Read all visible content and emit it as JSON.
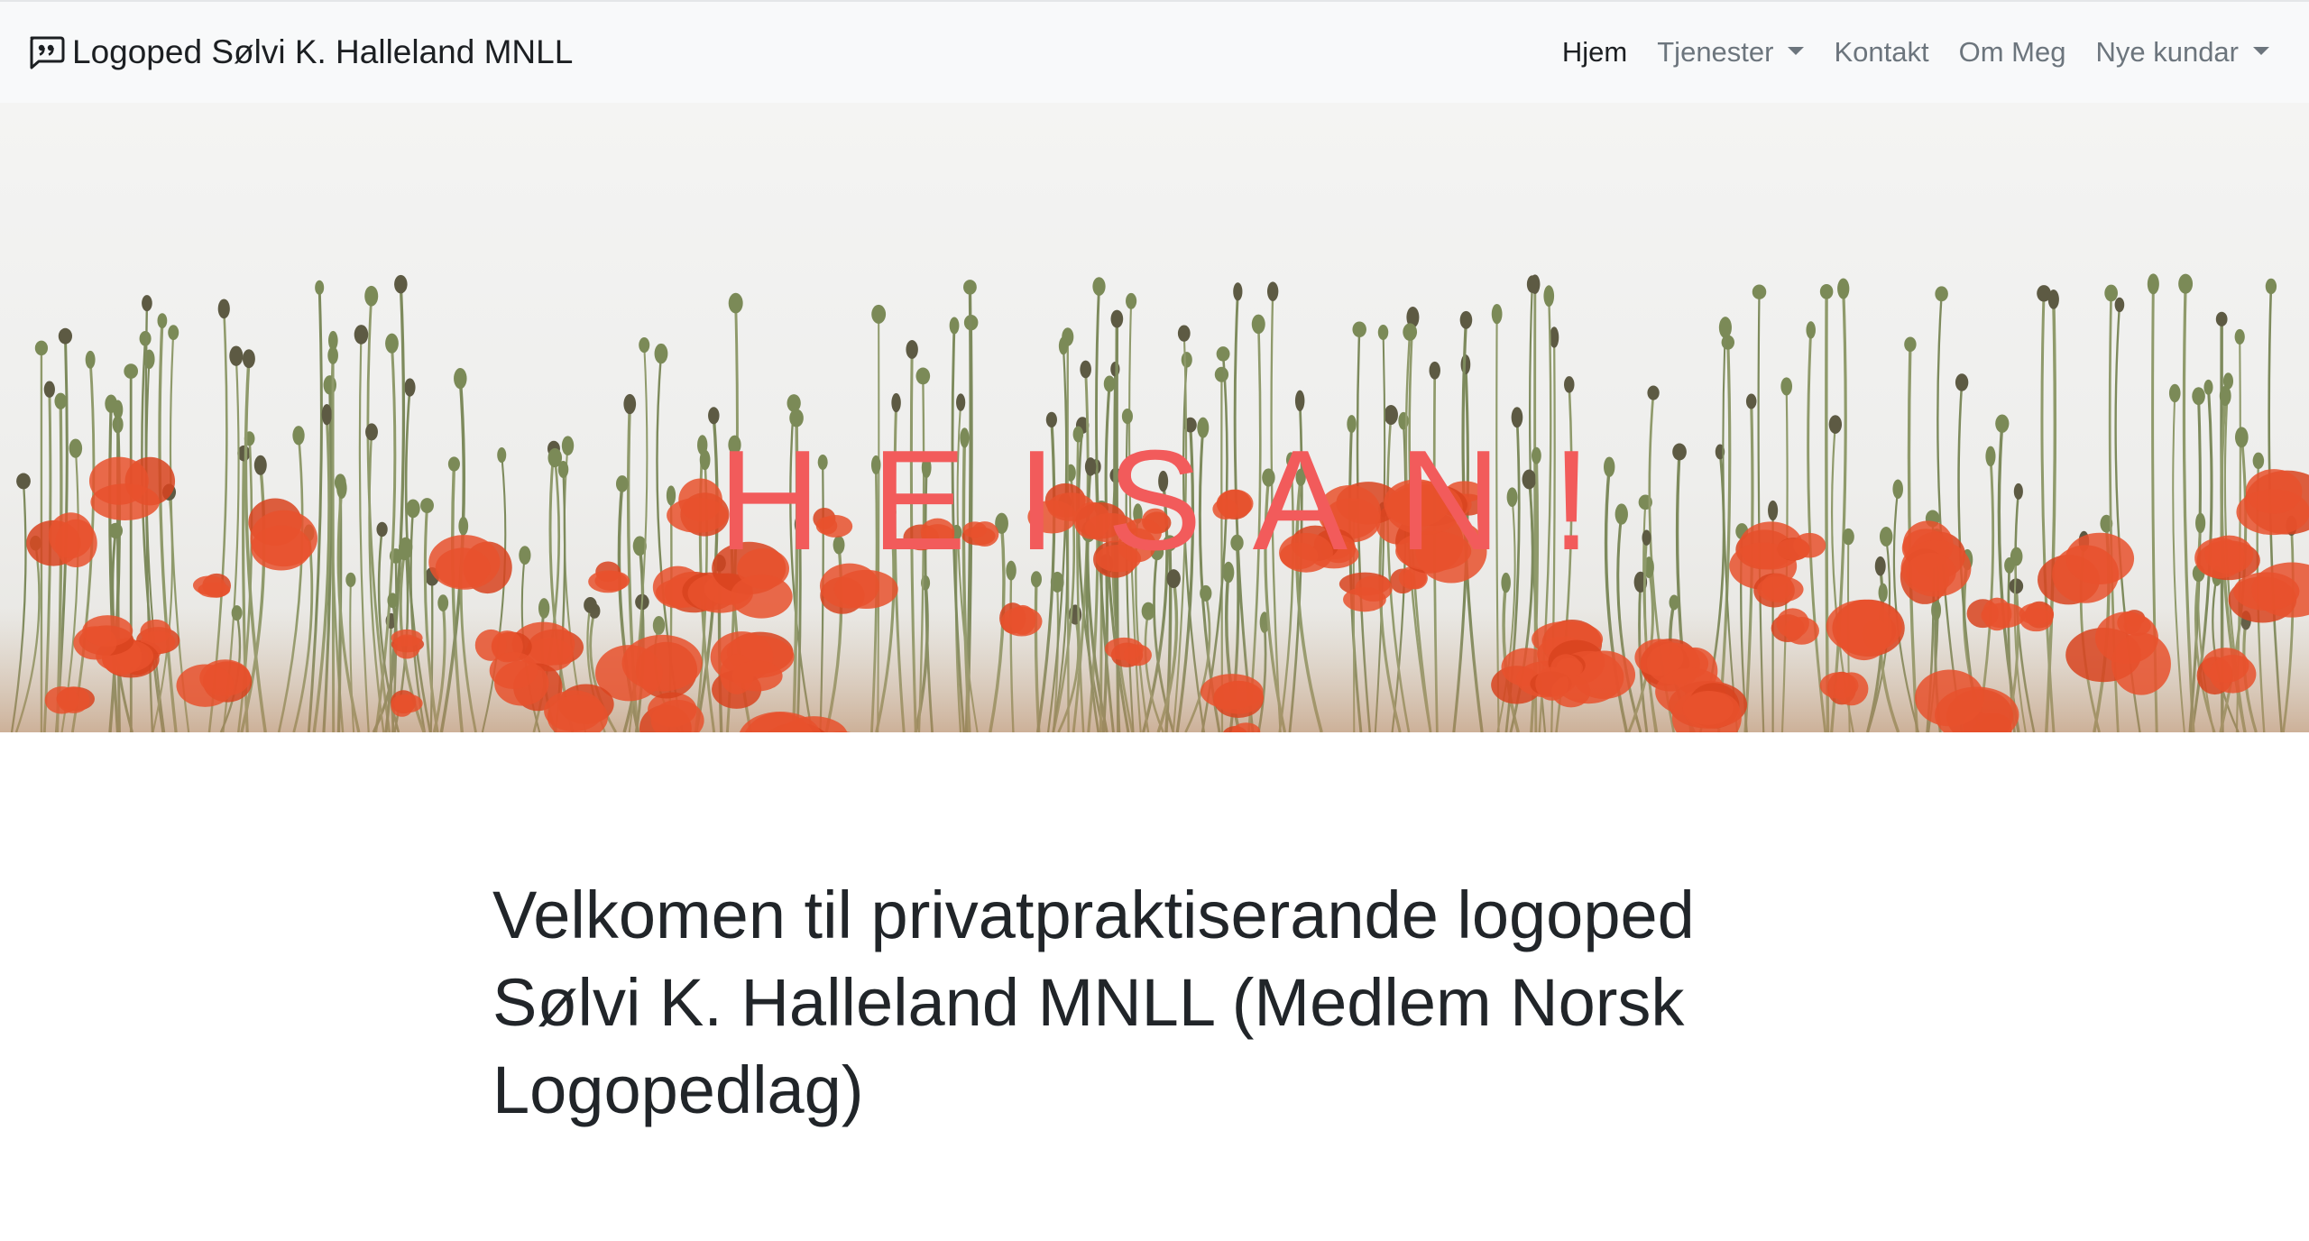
{
  "navbar": {
    "brand": "Logoped Sølvi K. Halleland MNLL",
    "brand_icon": "chat-quote-icon",
    "items": [
      {
        "label": "Hjem",
        "active": true,
        "dropdown": false
      },
      {
        "label": "Tjenester",
        "active": false,
        "dropdown": true
      },
      {
        "label": "Kontakt",
        "active": false,
        "dropdown": false
      },
      {
        "label": "Om Meg",
        "active": false,
        "dropdown": false
      },
      {
        "label": "Nye kundar",
        "active": false,
        "dropdown": true
      }
    ]
  },
  "hero": {
    "title": "HEISAN!",
    "title_color": "#f25b5b",
    "background": "poppy-field-photo"
  },
  "main": {
    "welcome": "Velkomen til privatpraktiserande logoped Sølvi K. Halleland MNLL (Medlem Norsk Logopedlag)"
  },
  "colors": {
    "navbar_bg": "#f8f9fa",
    "nav_active": "#1c1f22",
    "nav_inactive": "#6c757d",
    "poppy_red": "#e8512d"
  }
}
